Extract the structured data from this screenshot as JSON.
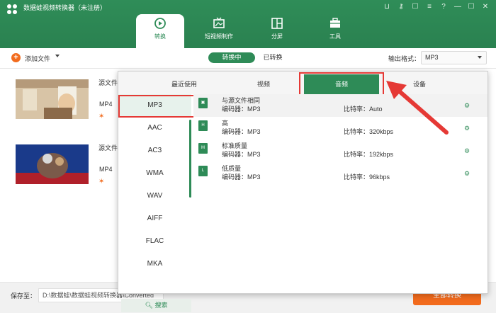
{
  "app": {
    "title": "数据蛙视频转换器（未注册）"
  },
  "nav_tabs": [
    {
      "label": "转换",
      "icon": "convert-icon"
    },
    {
      "label": "短视频制作",
      "icon": "tv-icon"
    },
    {
      "label": "分屏",
      "icon": "split-screen-icon"
    },
    {
      "label": "工具",
      "icon": "toolbox-icon"
    }
  ],
  "toolbar": {
    "add_file": "添加文件",
    "converting": "转换中",
    "converted": "已转换",
    "output_format_label": "输出格式：",
    "output_format_value": "MP3"
  },
  "files": [
    {
      "source_label": "源文件",
      "format": "MP4"
    },
    {
      "source_label": "源文件",
      "format": "MP4"
    }
  ],
  "bottom": {
    "save_label": "保存至：",
    "save_path": "D:\\数据蛙\\数据蛙视频转换器\\Converted",
    "convert_all": "全部转换"
  },
  "popup": {
    "tabs": [
      "最近使用",
      "视频",
      "音频",
      "设备"
    ],
    "active_tab": "音频",
    "formats": [
      "MP3",
      "AAC",
      "AC3",
      "WMA",
      "WAV",
      "AIFF",
      "FLAC",
      "MKA"
    ],
    "selected_format": "MP3",
    "search": "搜索",
    "qualities": [
      {
        "name": "与源文件相同",
        "encoder": "编码器：MP3",
        "bitrate": "比特率：Auto"
      },
      {
        "name": "高",
        "encoder": "编码器：MP3",
        "bitrate": "比特率：320kbps"
      },
      {
        "name": "标准质量",
        "encoder": "编码器：MP3",
        "bitrate": "比特率：192kbps"
      },
      {
        "name": "低质量",
        "encoder": "编码器：MP3",
        "bitrate": "比特率：96kbps"
      }
    ]
  },
  "colors": {
    "brand": "#2e8b57",
    "accent": "#f26b1d",
    "highlight": "#e53935"
  }
}
